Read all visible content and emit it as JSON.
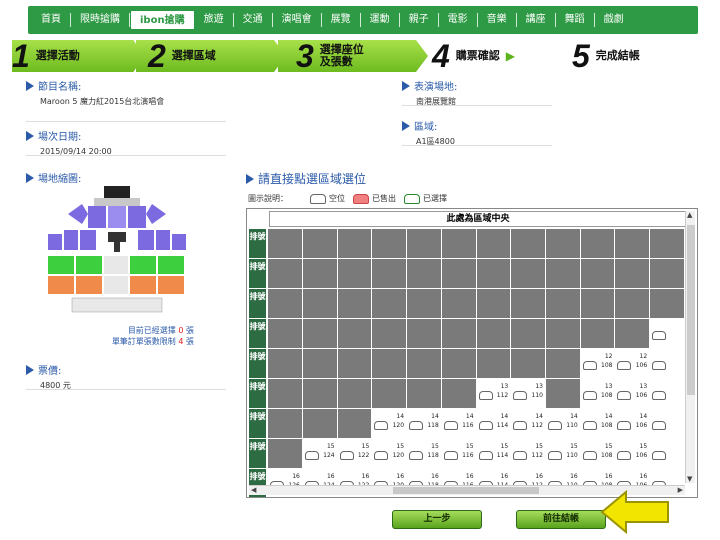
{
  "nav": [
    "首頁",
    "限時搶購",
    "ibon搶購",
    "旅遊",
    "交通",
    "演唱會",
    "展覽",
    "運動",
    "親子",
    "電影",
    "音樂",
    "講座",
    "舞蹈",
    "戲劇"
  ],
  "nav_active": 2,
  "steps": [
    {
      "num": "1",
      "label": "選擇活動"
    },
    {
      "num": "2",
      "label": "選擇區域"
    },
    {
      "num": "3",
      "label": "選擇座位及張數"
    },
    {
      "num": "4",
      "label": "購票確認"
    },
    {
      "num": "5",
      "label": "完成結帳"
    }
  ],
  "event": {
    "title": "節目名稱:",
    "value": "Maroon 5 魔力紅2015台北演唱會"
  },
  "venue": {
    "title": "表演場地:",
    "value": "南港展覽館"
  },
  "date": {
    "title": "場次日期:",
    "value": "2015/09/14 20:00"
  },
  "area": {
    "title": "區域:",
    "value": "A1區4800"
  },
  "map": {
    "title": "場地縮圖:"
  },
  "summary": {
    "selected_label": "目前已經選擇",
    "selected_count": "0",
    "selected_unit": "張",
    "limit_label": "單筆訂單張數限制",
    "limit_count": "4",
    "limit_unit": "張"
  },
  "price": {
    "title": "票價:",
    "value": "4800 元"
  },
  "selection": {
    "title": "請直接點選區域選位",
    "legend_label": "圖示說明：",
    "legend_empty": "空位",
    "legend_sold": "已售出",
    "legend_chosen": "已選擇",
    "header": "此處為區域中央"
  },
  "row_label": "排號",
  "seat_rows": [
    {
      "row": "",
      "seats": []
    },
    {
      "row": "",
      "seats": []
    },
    {
      "row": "",
      "seats": []
    },
    {
      "row": "11",
      "seats": [
        {
          "col": 11,
          "n": ""
        }
      ]
    },
    {
      "row": "12",
      "seats": [
        {
          "col": 9,
          "n": "108"
        },
        {
          "col": 10,
          "n": "106"
        },
        {
          "col": 11,
          "n": ""
        }
      ]
    },
    {
      "row": "13",
      "seats": [
        {
          "col": 6,
          "n": "112"
        },
        {
          "col": 7,
          "n": "110"
        },
        {
          "col": 9,
          "n": "108"
        },
        {
          "col": 10,
          "n": "106"
        },
        {
          "col": 11,
          "n": ""
        }
      ]
    },
    {
      "row": "14",
      "seats": [
        {
          "col": 3,
          "n": "120"
        },
        {
          "col": 4,
          "n": "118"
        },
        {
          "col": 5,
          "n": "116"
        },
        {
          "col": 6,
          "n": "114"
        },
        {
          "col": 7,
          "n": "112"
        },
        {
          "col": 8,
          "n": "110"
        },
        {
          "col": 9,
          "n": "108"
        },
        {
          "col": 10,
          "n": "106"
        },
        {
          "col": 11,
          "n": ""
        }
      ]
    },
    {
      "row": "15",
      "seats": [
        {
          "col": 1,
          "n": "124"
        },
        {
          "col": 2,
          "n": "122"
        },
        {
          "col": 3,
          "n": "120"
        },
        {
          "col": 4,
          "n": "118"
        },
        {
          "col": 5,
          "n": "116"
        },
        {
          "col": 6,
          "n": "114"
        },
        {
          "col": 7,
          "n": "112"
        },
        {
          "col": 8,
          "n": "110"
        },
        {
          "col": 9,
          "n": "108"
        },
        {
          "col": 10,
          "n": "106"
        },
        {
          "col": 11,
          "n": ""
        }
      ]
    },
    {
      "row": "16",
      "seats": [
        {
          "col": 0,
          "n": "126"
        },
        {
          "col": 1,
          "n": "124"
        },
        {
          "col": 2,
          "n": "122"
        },
        {
          "col": 3,
          "n": "120"
        },
        {
          "col": 4,
          "n": "118"
        },
        {
          "col": 5,
          "n": "116"
        },
        {
          "col": 6,
          "n": "114"
        },
        {
          "col": 7,
          "n": "112"
        },
        {
          "col": 8,
          "n": "110"
        },
        {
          "col": 9,
          "n": "108"
        },
        {
          "col": 10,
          "n": "106"
        },
        {
          "col": 11,
          "n": ""
        }
      ]
    }
  ],
  "buttons": {
    "back": "上一步",
    "next": "前往結帳"
  },
  "colors": {
    "nav_green": "#2f9a45",
    "step_green": "#7dc72a",
    "title_blue": "#2a5aa8",
    "sold_gray": "#7a7a7a",
    "row_label_green": "#2d6b43",
    "arrow_yellow": "#f2e600"
  }
}
